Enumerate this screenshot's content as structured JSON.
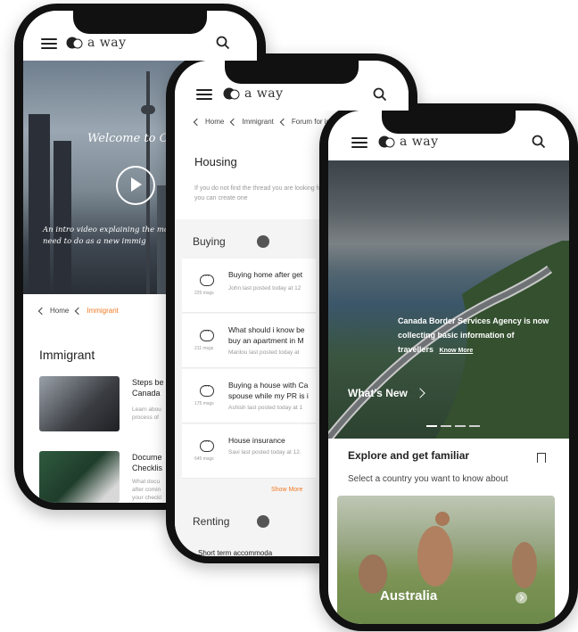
{
  "brand": {
    "name": "a way"
  },
  "phone1": {
    "hero_title": "Welcome to Can",
    "hero_desc": "An intro video explaining the most im things you need to do as a new immig",
    "breadcrumb": {
      "home": "Home",
      "current": "Immigrant"
    },
    "section_title": "Immigrant",
    "cards": [
      {
        "title": "Steps be",
        "title2": "Canada",
        "desc": "Learn abou",
        "desc2": "process of"
      },
      {
        "title": "Docume",
        "title2": "Checklis",
        "desc": "What docu",
        "desc2": "after comin",
        "desc3": "your checkl"
      }
    ]
  },
  "phone2": {
    "breadcrumb": {
      "home": "Home",
      "mid": "Immigrant",
      "current": "Forum for immig"
    },
    "title": "Housing",
    "desc": "If you do not find the thread you are looking for, you can create one",
    "groups": {
      "buying": "Buying",
      "renting": "Renting"
    },
    "threads": [
      {
        "title": "Buying home after get",
        "title2": "",
        "sub": "John last posted today at 12",
        "msgs": "225 msgs"
      },
      {
        "title": "What should i know be",
        "title2": "buy an apartment in M",
        "sub": "Marilou last posted today at",
        "msgs": "211 msgs"
      },
      {
        "title": "Buying a house with Ca",
        "title2": "spouse while my PR is i",
        "sub": "Ashish last posted today at 1",
        "msgs": "175 msgs"
      },
      {
        "title": "House insurance",
        "title2": "",
        "sub": "Savi last posted today at 12.",
        "msgs": "645 msgs"
      }
    ],
    "show_more": "Show More",
    "renting_first": "Short term accommoda"
  },
  "phone3": {
    "hero_text": "Canada Border Services Agency is now collecting basic information of travellers",
    "know_more": "Know More",
    "whats_new": "What's New",
    "explore_title": "Explore and get familiar",
    "explore_sub": "Select a country you want to know about",
    "country": "Australia"
  }
}
